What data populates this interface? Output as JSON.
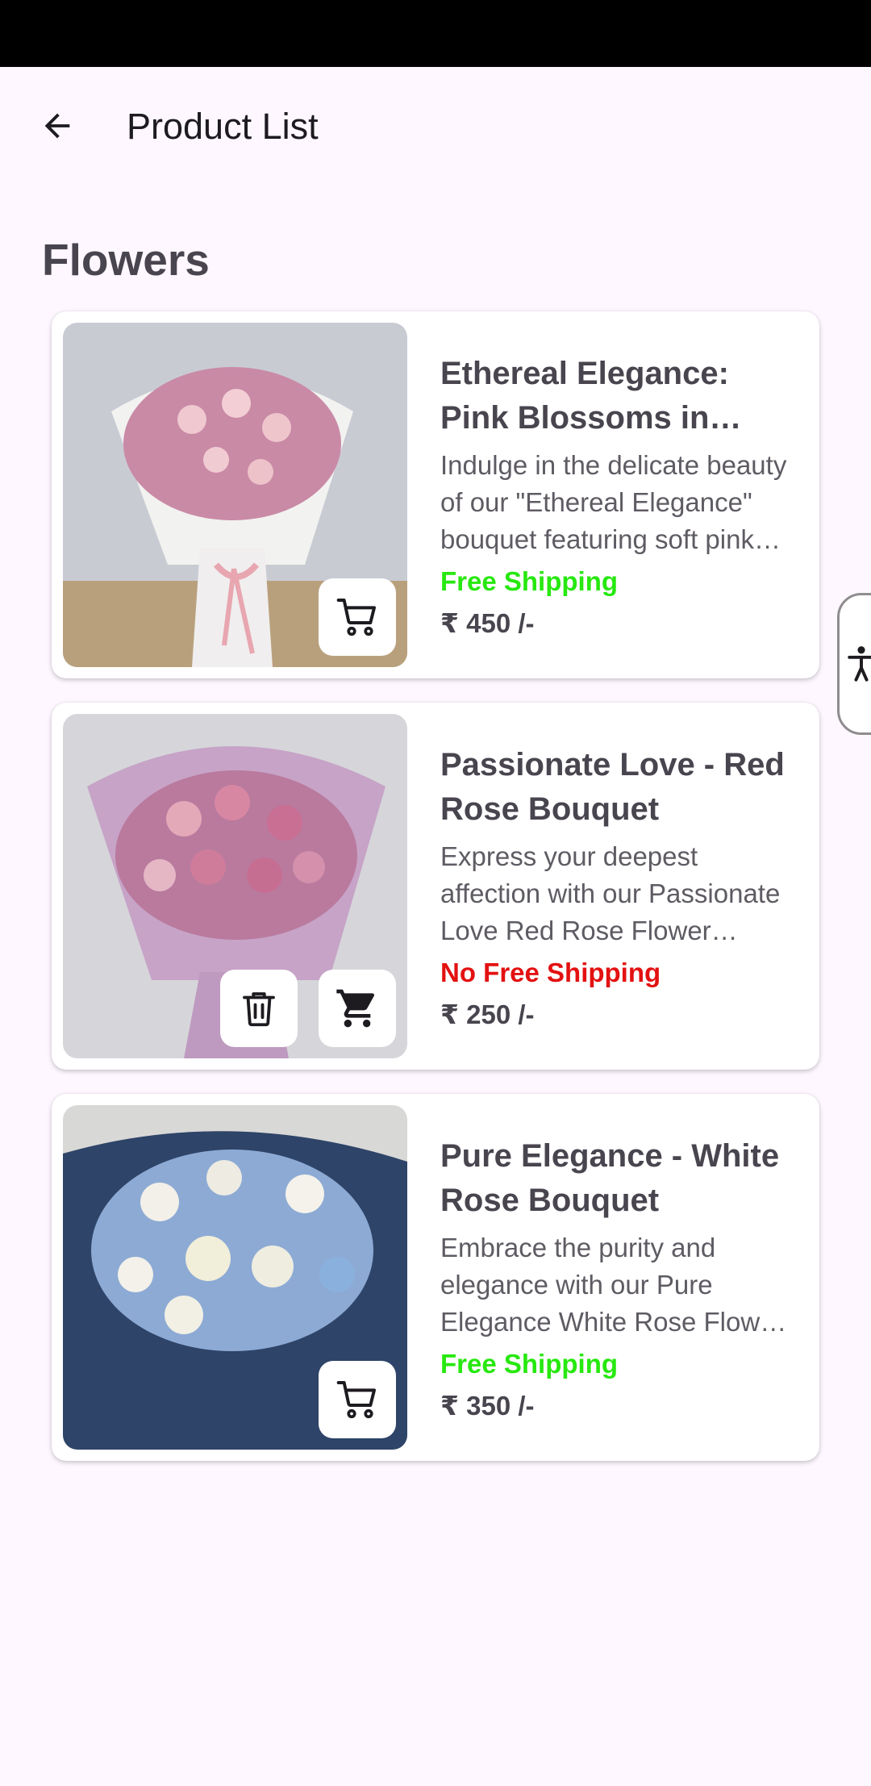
{
  "app_bar": {
    "title": "Product List",
    "back_icon": "arrow-left-icon"
  },
  "section": {
    "title": "Flowers"
  },
  "products": [
    {
      "name": "Ethereal Elegance: Pink Blossoms in White Wrap",
      "description": "Indulge in the delicate beauty of our \"Ethereal Elegance\" bouquet featuring soft pink roses and baby's breath.",
      "shipping": "Free Shipping",
      "free_shipping": true,
      "price": "₹ 450 /-",
      "in_cart": false
    },
    {
      "name": "Passionate Love - Red Rose Bouquet",
      "description": "Express your deepest affection with our Passionate Love Red Rose Flower Bouquet, a timeless gift.",
      "shipping": "No Free Shipping",
      "free_shipping": false,
      "price": "₹ 250 /-",
      "in_cart": true
    },
    {
      "name": "Pure Elegance - White Rose Bouquet",
      "description": "Embrace the purity and elegance with our Pure Elegance White Rose Flower Bouquet for every occasion.",
      "shipping": "Free Shipping",
      "free_shipping": true,
      "price": "₹ 350 /-",
      "in_cart": false
    }
  ],
  "colors": {
    "background": "#FEF7FF",
    "free_shipping": "#27E80F",
    "no_free_shipping": "#E31111",
    "title_text": "#49454F"
  }
}
